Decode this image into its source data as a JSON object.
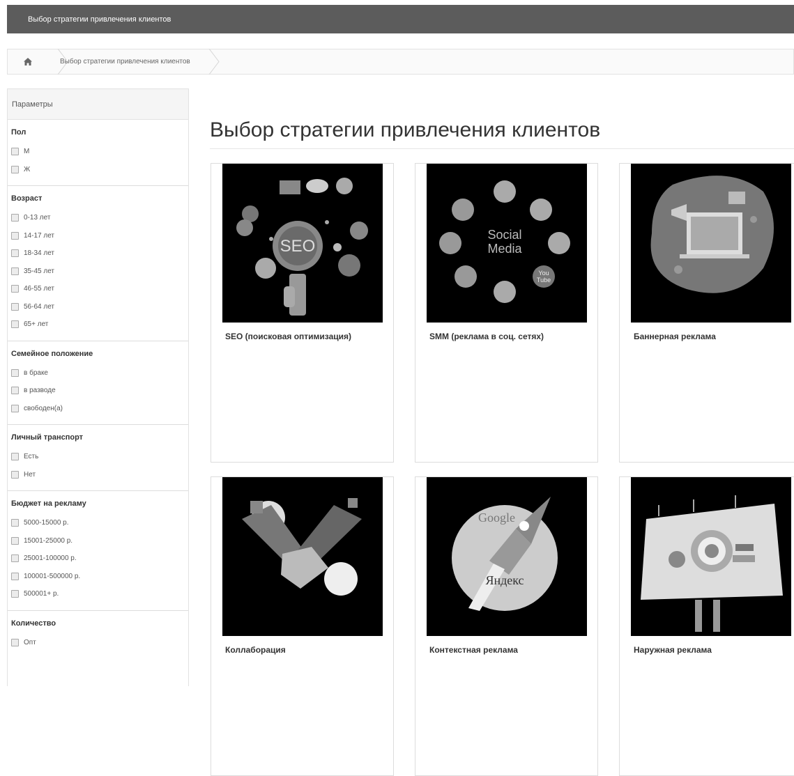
{
  "header": {
    "title": "Выбор стратегии привлечения клиентов"
  },
  "breadcrumb": {
    "home_icon": "home-icon",
    "current": "Выбор стратегии привлечения клиентов"
  },
  "sidebar": {
    "title": "Параметры",
    "groups": [
      {
        "title": "Пол",
        "options": [
          "М",
          "Ж"
        ]
      },
      {
        "title": "Возраст",
        "options": [
          "0-13 лет",
          "14-17 лет",
          "18-34 лет",
          "35-45 лет",
          "46-55 лет",
          "56-64 лет",
          "65+ лет"
        ]
      },
      {
        "title": "Семейное положение",
        "options": [
          "в браке",
          "в разводе",
          "свободен(а)"
        ]
      },
      {
        "title": "Личный транспорт",
        "options": [
          "Есть",
          "Нет"
        ]
      },
      {
        "title": "Бюджет на рекламу",
        "options": [
          "5000-15000 р.",
          "15001-25000 р.",
          "25001-100000 р.",
          "100001-500000 р.",
          "500001+ р."
        ]
      },
      {
        "title": "Количество",
        "options": [
          "Опт"
        ]
      }
    ]
  },
  "main": {
    "title": "Выбор стратегии привлечения клиентов",
    "cards": [
      {
        "title": "SEO (поисковая оптимизация)",
        "image_text": "SEO"
      },
      {
        "title": "SMM (реклама в соц. сетях)",
        "image_text_1": "Social",
        "image_text_2": "Media",
        "image_text_3": "You",
        "image_text_4": "Tube"
      },
      {
        "title": "Баннерная реклама"
      },
      {
        "title": "Коллаборация"
      },
      {
        "title": "Контекстная реклама",
        "image_text_1": "Google",
        "image_text_2": "Яндекс"
      },
      {
        "title": "Наружная реклама"
      }
    ]
  }
}
